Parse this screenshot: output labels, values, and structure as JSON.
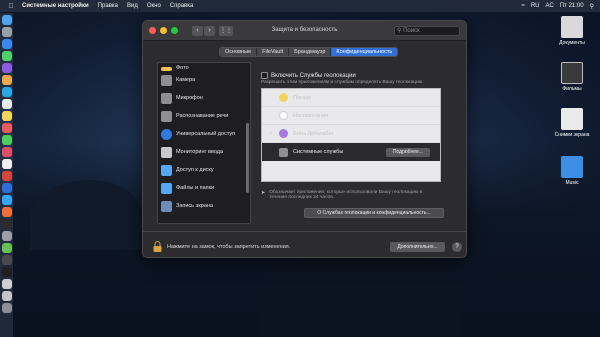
{
  "menubar": {
    "app_name": "Системные настройки",
    "items": [
      "Правка",
      "Вид",
      "Окно",
      "Справка"
    ],
    "status_lang": "RU",
    "time": "Пт 21:00",
    "user": "AC"
  },
  "desktop": {
    "items": [
      {
        "label": "Документы",
        "color": "#d9d9dc"
      },
      {
        "label": "Фильмы",
        "color": "#3a3a3c"
      },
      {
        "label": "Снимки экрана",
        "color": "#eaeaea"
      },
      {
        "label": "Music",
        "color": "#3d8fe6"
      }
    ]
  },
  "window": {
    "title": "Защита и безопасность",
    "search_placeholder": "Поиск",
    "tabs": [
      {
        "label": "Основные",
        "active": false
      },
      {
        "label": "FileVault",
        "active": false
      },
      {
        "label": "Брандмауэр",
        "active": false
      },
      {
        "label": "Конфиденциальность",
        "active": true
      }
    ],
    "list": [
      {
        "label": "Фото",
        "icon": "photos-icon",
        "color": "#f2c14e",
        "partial": true
      },
      {
        "label": "Камера",
        "icon": "camera-icon",
        "color": "#8e8e93"
      },
      {
        "label": "Микрофон",
        "icon": "microphone-icon",
        "color": "#8e8e93"
      },
      {
        "label": "Распознавание речи",
        "icon": "speech-icon",
        "color": "#8e8e93"
      },
      {
        "label": "Универсальный доступ",
        "icon": "accessibility-icon",
        "color": "#2f7de1"
      },
      {
        "label": "Мониторинг ввода",
        "icon": "keyboard-icon",
        "color": "#c7c7cc"
      },
      {
        "label": "Доступ к диску",
        "icon": "folder-icon",
        "color": "#56a7f0"
      },
      {
        "label": "Файлы и папки",
        "icon": "folder-icon",
        "color": "#56a7f0"
      },
      {
        "label": "Запись экрана",
        "icon": "screen-icon",
        "color": "#6c8fb8"
      }
    ],
    "enable_label": "Включить Службы геолокации",
    "hint": "Разрешить этим приложениям и службам определять Вашу геолокацию.",
    "apps": [
      {
        "label": "Погода",
        "checked": false,
        "color": "#f4d35e",
        "dark": false
      },
      {
        "label": "Напоминания",
        "checked": false,
        "color": "#ffffff",
        "dark": false
      },
      {
        "label": "Боты Дельтабот",
        "checked": true,
        "color": "#a37be0",
        "dark": false
      },
      {
        "label": "Системные службы",
        "checked": false,
        "color": "#8e8e93",
        "dark": true
      }
    ],
    "details_label": "Подробнее...",
    "indicator_text": "Обозначает приложения, которые использовали Вашу геолокацию в течение последних 24 часов.",
    "about_label": "О Службах геолокации и конфиденциальность...",
    "lock_text": "Нажмите на замок, чтобы запретить изменения.",
    "advanced_label": "Дополнительно...",
    "help_label": "?"
  }
}
